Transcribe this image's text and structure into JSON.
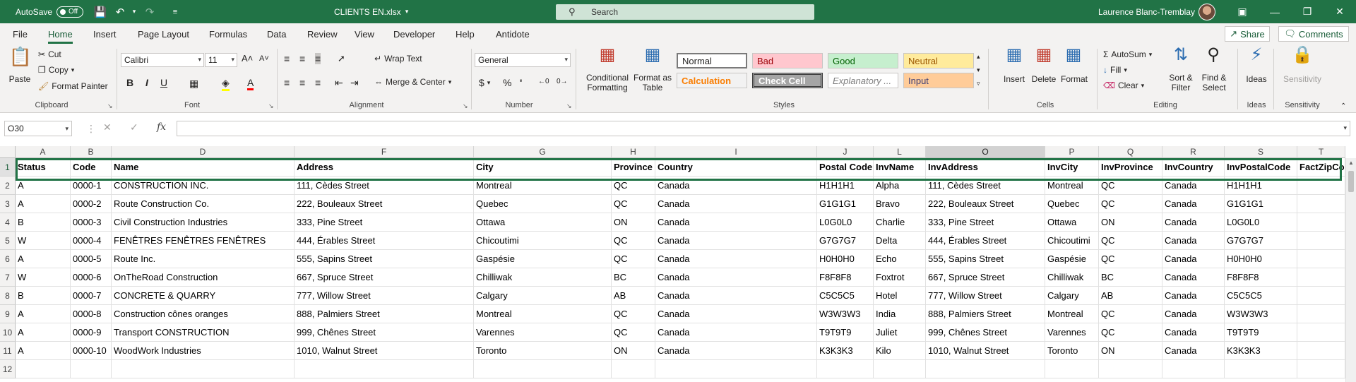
{
  "titlebar": {
    "autosave_label": "AutoSave",
    "autosave_state": "Off",
    "doc_title": "CLIENTS EN.xlsx",
    "search_placeholder": "Search",
    "user_name": "Laurence Blanc-Tremblay",
    "color": "#217346"
  },
  "tabs": [
    "File",
    "Home",
    "Insert",
    "Page Layout",
    "Formulas",
    "Data",
    "Review",
    "View",
    "Developer",
    "Help",
    "Antidote"
  ],
  "active_tab": "Home",
  "share_label": "Share",
  "comments_label": "Comments",
  "ribbon": {
    "clipboard": {
      "paste": "Paste",
      "cut": "Cut",
      "copy": "Copy",
      "format_painter": "Format Painter",
      "label": "Clipboard"
    },
    "font": {
      "family": "Calibri",
      "size": "11",
      "label": "Font"
    },
    "alignment": {
      "wrap_text": "Wrap Text",
      "merge_center": "Merge & Center",
      "label": "Alignment"
    },
    "number": {
      "format": "General",
      "label": "Number"
    },
    "styles": {
      "conditional": "Conditional Formatting",
      "format_as_table": "Format as Table",
      "normal": "Normal",
      "bad": "Bad",
      "good": "Good",
      "neutral": "Neutral",
      "calculation": "Calculation",
      "check_cell": "Check Cell",
      "explanatory": "Explanatory ...",
      "input": "Input",
      "label": "Styles"
    },
    "cells": {
      "insert": "Insert",
      "delete": "Delete",
      "format": "Format",
      "label": "Cells"
    },
    "editing": {
      "autosum": "AutoSum",
      "fill": "Fill",
      "clear": "Clear",
      "sort_filter": "Sort & Filter",
      "find_select": "Find & Select",
      "label": "Editing"
    },
    "ideas": {
      "ideas": "Ideas",
      "label": "Ideas"
    },
    "sensitivity": {
      "sensitivity": "Sensitivity",
      "label": "Sensitivity"
    }
  },
  "formula_bar": {
    "name_box": "O30",
    "fx": "fx",
    "formula": ""
  },
  "grid": {
    "columns": [
      "A",
      "B",
      "D",
      "F",
      "G",
      "H",
      "I",
      "J",
      "L",
      "O",
      "P",
      "Q",
      "R",
      "S",
      "T"
    ],
    "selected_column": "O",
    "row_numbers": [
      "1",
      "2",
      "3",
      "4",
      "5",
      "6",
      "7",
      "8",
      "9",
      "10",
      "11",
      "12"
    ],
    "selected_row": "1",
    "header": [
      "Status",
      "Code",
      "Name",
      "Address",
      "City",
      "Province",
      "Country",
      "Postal Code",
      "InvName",
      "InvAddress",
      "InvCity",
      "InvProvince",
      "InvCountry",
      "InvPostalCode",
      "FactZipCode"
    ],
    "rows": [
      [
        "A",
        "0000-1",
        "CONSTRUCTION INC.",
        "111, Cèdes Street",
        "Montreal",
        "QC",
        "Canada",
        "H1H1H1",
        "Alpha",
        "111, Cèdes Street",
        "Montreal",
        "QC",
        "Canada",
        "H1H1H1",
        ""
      ],
      [
        "A",
        "0000-2",
        "Route Construction Co.",
        "222, Bouleaux Street",
        "Quebec",
        "QC",
        "Canada",
        "G1G1G1",
        "Bravo",
        "222, Bouleaux Street",
        "Quebec",
        "QC",
        "Canada",
        "G1G1G1",
        ""
      ],
      [
        "B",
        "0000-3",
        "Civil Construction Industries",
        "333, Pine Street",
        "Ottawa",
        "ON",
        "Canada",
        "L0G0L0",
        "Charlie",
        "333, Pine Street",
        "Ottawa",
        "ON",
        "Canada",
        "L0G0L0",
        ""
      ],
      [
        "W",
        "0000-4",
        "FENÊTRES FENÊTRES FENÊTRES",
        "444, Érables Street",
        "Chicoutimi",
        "QC",
        "Canada",
        "G7G7G7",
        "Delta",
        "444, Érables Street",
        "Chicoutimi",
        "QC",
        "Canada",
        "G7G7G7",
        ""
      ],
      [
        "A",
        "0000-5",
        "Route Inc.",
        "555, Sapins Street",
        "Gaspésie",
        "QC",
        "Canada",
        "H0H0H0",
        "Echo",
        "555, Sapins Street",
        "Gaspésie",
        "QC",
        "Canada",
        "H0H0H0",
        ""
      ],
      [
        "W",
        "0000-6",
        "OnTheRoad Construction",
        "667, Spruce Street",
        "Chilliwak",
        "BC",
        "Canada",
        "F8F8F8",
        "Foxtrot",
        "667, Spruce Street",
        "Chilliwak",
        "BC",
        "Canada",
        "F8F8F8",
        ""
      ],
      [
        "B",
        "0000-7",
        "CONCRETE & QUARRY",
        "777, Willow Street",
        "Calgary",
        "AB",
        "Canada",
        "C5C5C5",
        "Hotel",
        "777, Willow Street",
        "Calgary",
        "AB",
        "Canada",
        "C5C5C5",
        ""
      ],
      [
        "A",
        "0000-8",
        "Construction cônes oranges",
        "888, Palmiers Street",
        "Montreal",
        "QC",
        "Canada",
        "W3W3W3",
        "India",
        "888, Palmiers Street",
        "Montreal",
        "QC",
        "Canada",
        "W3W3W3",
        ""
      ],
      [
        "A",
        "0000-9",
        "Transport CONSTRUCTION",
        "999, Chênes Street",
        "Varennes",
        "QC",
        "Canada",
        "T9T9T9",
        "Juliet",
        "999, Chênes Street",
        "Varennes",
        "QC",
        "Canada",
        "T9T9T9",
        ""
      ],
      [
        "A",
        "0000-10",
        "WoodWork Industries",
        "1010, Walnut Street",
        "Toronto",
        "ON",
        "Canada",
        "K3K3K3",
        "Kilo",
        "1010, Walnut Street",
        "Toronto",
        "ON",
        "Canada",
        "K3K3K3",
        ""
      ],
      [
        "",
        "",
        "",
        "",
        "",
        "",
        "",
        "",
        "",
        "",
        "",
        "",
        "",
        "",
        ""
      ]
    ]
  }
}
